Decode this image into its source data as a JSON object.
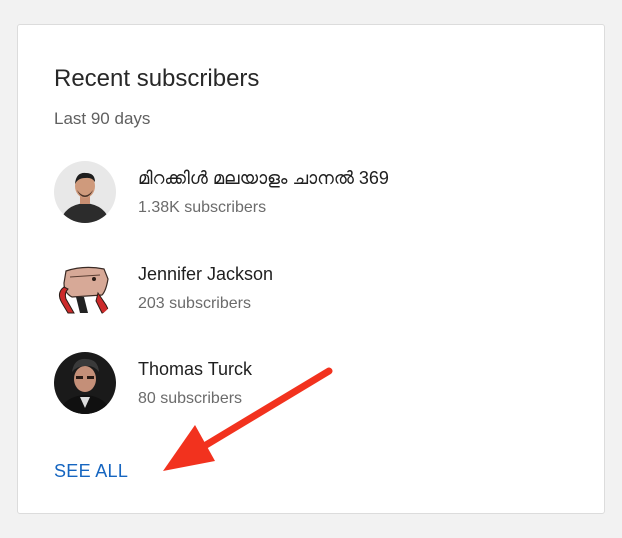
{
  "card": {
    "title": "Recent subscribers",
    "subtitle": "Last 90 days",
    "subscribers": [
      {
        "name": "മിറക്കിൾ മലയാളം ചാനൽ 369",
        "count": "1.38K subscribers"
      },
      {
        "name": "Jennifer Jackson",
        "count": "203 subscribers"
      },
      {
        "name": "Thomas Turck",
        "count": "80 subscribers"
      }
    ],
    "see_all_label": "SEE ALL"
  },
  "colors": {
    "link": "#1565c0",
    "annotation_arrow": "#f2321e"
  }
}
